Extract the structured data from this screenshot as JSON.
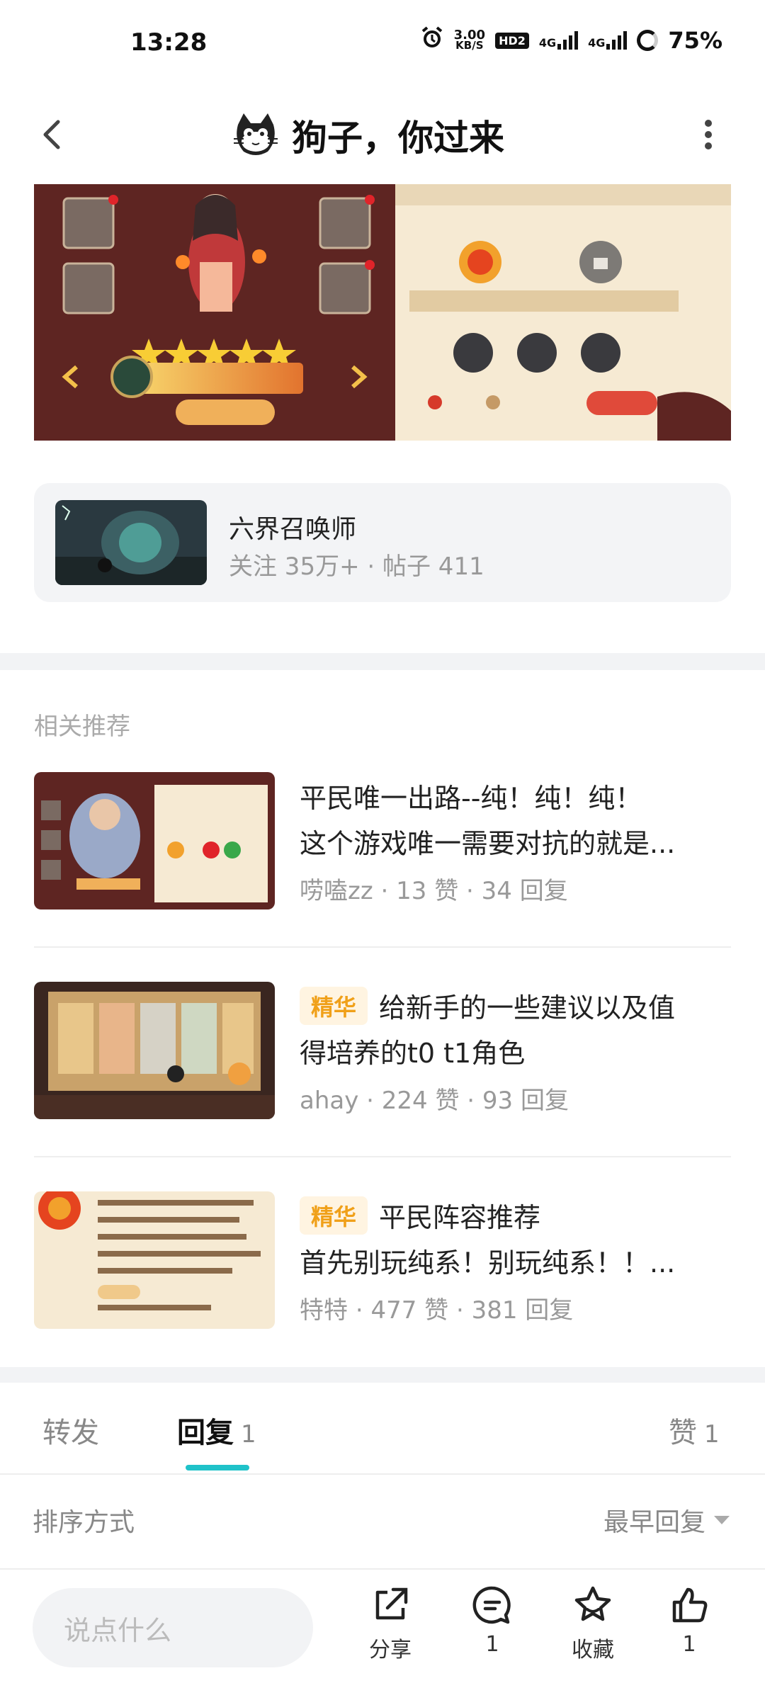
{
  "status_bar": {
    "time": "13:28",
    "net_speed_value": "3.00",
    "net_speed_unit": "KB/S",
    "hd_badge": "HD2",
    "signal1": "4G",
    "signal2": "4G",
    "battery": "75%"
  },
  "header": {
    "title": "狗子，你过来"
  },
  "forum_card": {
    "name": "六界召唤师",
    "followers": "关注 35万+",
    "posts": "帖子 411"
  },
  "related": {
    "label": "相关推荐",
    "items": [
      {
        "tag": "",
        "title_line1": "平民唯一出路--纯！纯！纯！",
        "title_line2": "这个游戏唯一需要对抗的就是...",
        "author": "唠嗑zz",
        "likes": "13 赞",
        "replies": "34 回复"
      },
      {
        "tag": "精华",
        "title_line1": "给新手的一些建议以及值",
        "title_line2": "得培养的t0 t1角色",
        "author": "ahay",
        "likes": "224 赞",
        "replies": "93 回复"
      },
      {
        "tag": "精华",
        "title_line1": "平民阵容推荐",
        "title_line2": "首先别玩纯系！别玩纯系！！...",
        "author": "特特",
        "likes": "477 赞",
        "replies": "381 回复"
      }
    ]
  },
  "tabs": {
    "forward": "转发",
    "reply": "回复",
    "reply_count": "1",
    "like": "赞",
    "like_count": "1"
  },
  "sort": {
    "label": "排序方式",
    "value": "最早回复"
  },
  "bottom_bar": {
    "input_placeholder": "说点什么",
    "share": "分享",
    "comment_count": "1",
    "collect": "收藏",
    "like_count": "1"
  },
  "colors": {
    "accent": "#1fc2c9",
    "tag_bg": "#fff4e1",
    "tag_text": "#f0a019"
  }
}
